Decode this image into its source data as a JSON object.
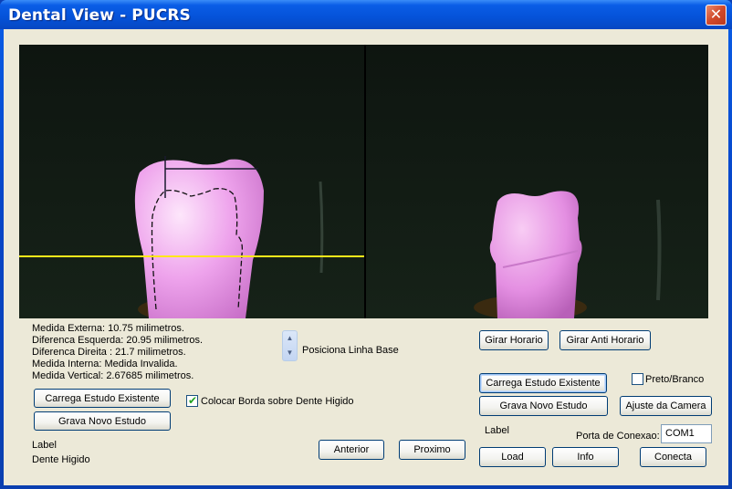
{
  "window": {
    "title": "Dental View - PUCRS",
    "close_glyph": "✕"
  },
  "measurements": {
    "externa": "Medida Externa: 10.75 milimetros.",
    "esquerda": "Diferenca Esquerda: 20.95 milimetros.",
    "direita": "Diferenca Direita : 21.7 milimetros.",
    "interna": "Medida Interna: Medida Invalida.",
    "vertical": "Medida Vertical: 2.67685 milimetros."
  },
  "left_controls": {
    "carrega_label": "Carrega Estudo Existente",
    "grava_label": "Grava Novo Estudo",
    "status_label": "Label",
    "status_value": "Dente Higido"
  },
  "center_controls": {
    "checkbox_label": "Colocar Borda sobre Dente Higido",
    "checkbox_checked": true,
    "spin_label": "Posiciona Linha Base",
    "spin_up_icon": "chevron-up-icon",
    "spin_down_icon": "chevron-down-icon",
    "anterior_label": "Anterior",
    "proximo_label": "Proximo"
  },
  "right_controls": {
    "girar_horario_label": "Girar Horario",
    "girar_anti_label": "Girar Anti Horario",
    "carrega_label": "Carrega Estudo Existente",
    "preto_branco_label": "Preto/Branco",
    "preto_branco_checked": false,
    "grava_label": "Grava Novo Estudo",
    "ajuste_label": "Ajuste da Camera",
    "label_text": "Label",
    "porta_label": "Porta de Conexao:",
    "porta_value": "COM1",
    "load_label": "Load",
    "info_label": "Info",
    "conecta_label": "Conecta"
  },
  "colors": {
    "baseline": "#ffe81a",
    "tooth": "#ec9bec",
    "title_bar": "#0552d8"
  }
}
